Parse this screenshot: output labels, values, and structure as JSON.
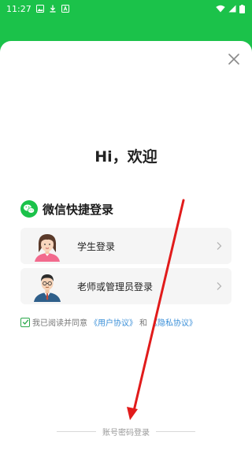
{
  "status_bar": {
    "time": "11:27",
    "left_icons": [
      "image-icon",
      "download-icon",
      "app-icon"
    ],
    "right_icons": [
      "wifi-icon",
      "signal-icon",
      "battery-icon"
    ]
  },
  "sheet": {
    "greeting": "Hi，欢迎",
    "wechat_title": "微信快捷登录",
    "options": [
      {
        "label": "学生登录",
        "icon": "student-avatar-icon"
      },
      {
        "label": "老师或管理员登录",
        "icon": "teacher-avatar-icon"
      }
    ],
    "agreement": {
      "prefix": "我已阅读并同意",
      "user_agreement": "《用户协议》",
      "and": "和",
      "privacy_agreement": "《隐私协议》",
      "checked": true
    },
    "password_login": "账号密码登录"
  },
  "colors": {
    "brand_green": "#1bc24a",
    "link_blue": "#3a8fd8",
    "annotation_red": "#e11b1b"
  }
}
